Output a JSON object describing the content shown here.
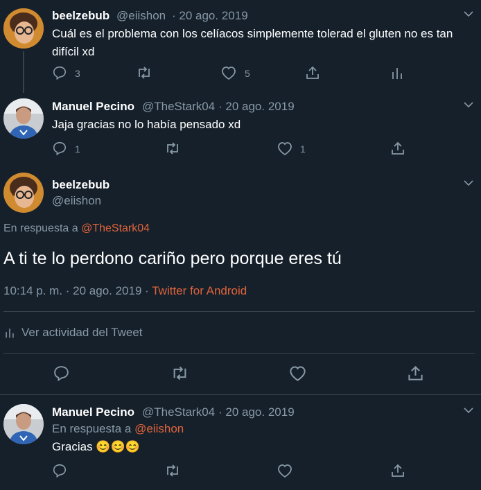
{
  "tweets": [
    {
      "name": "beelzebub",
      "handle": "@eiishon",
      "date": "· 20 ago. 2019",
      "text": "Cuál es el problema con los celíacos simplemente tolerad el gluten no es tan difícil xd",
      "replies": "3",
      "likes": "5"
    },
    {
      "name": "Manuel Pecino",
      "handle": "@TheStark04",
      "date": "· 20 ago. 2019",
      "text": "Jaja gracias no lo había pensado xd",
      "replies": "1",
      "likes": "1"
    }
  ],
  "main_tweet": {
    "name": "beelzebub",
    "handle": "@eiishon",
    "reply_prefix": "En respuesta a",
    "reply_to": "@TheStark04",
    "text": "A ti te lo perdono cariño pero porque eres tú",
    "timestamp": "10:14 p. m. · 20 ago. 2019 ·",
    "source": "Twitter for Android",
    "activity": "Ver actividad del Tweet"
  },
  "reply_tweet": {
    "name": "Manuel Pecino",
    "handle": "@TheStark04",
    "date": "· 20 ago. 2019",
    "reply_prefix": "En respuesta a",
    "reply_to": "@eiishon",
    "text": "Gracias",
    "emojis": "😊😊😊"
  },
  "colors": {
    "background": "#15202b",
    "secondary_text": "#8899a6",
    "accent": "#e0633a",
    "divider": "#38444d"
  }
}
